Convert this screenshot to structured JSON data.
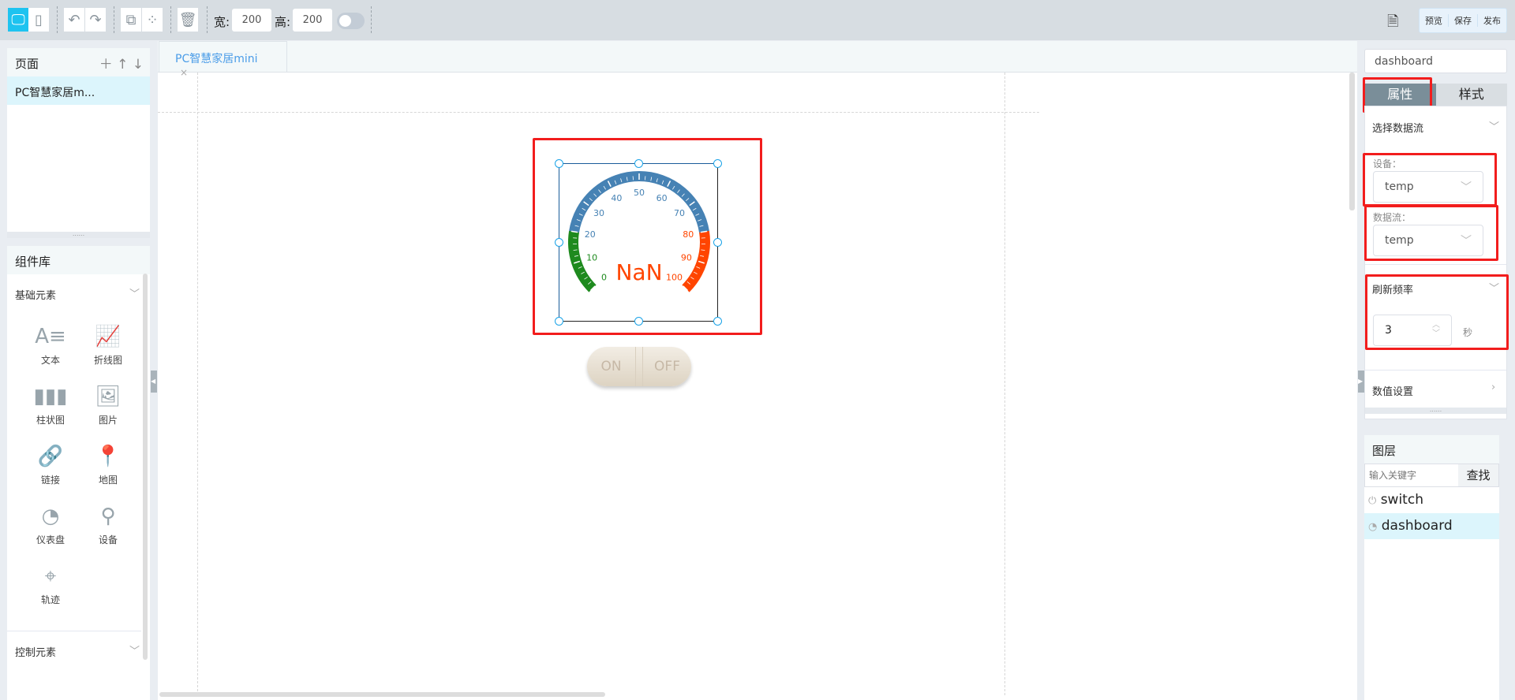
{
  "toolbar": {
    "width_label": "宽:",
    "width_value": "200",
    "height_label": "高:",
    "height_value": "200",
    "preview": "预览",
    "save": "保存",
    "publish": "发布"
  },
  "pages": {
    "title": "页面",
    "items": [
      "PC智慧家居m..."
    ]
  },
  "tab": {
    "label": "PC智慧家居mini",
    "close": "×"
  },
  "library": {
    "title": "组件库",
    "basic": "基础元素",
    "control": "控制元素",
    "items": [
      {
        "label": "文本",
        "icon": "text-icon"
      },
      {
        "label": "折线图",
        "icon": "line-chart-icon"
      },
      {
        "label": "柱状图",
        "icon": "bar-chart-icon"
      },
      {
        "label": "图片",
        "icon": "image-icon"
      },
      {
        "label": "链接",
        "icon": "link-icon"
      },
      {
        "label": "地图",
        "icon": "map-pin-icon"
      },
      {
        "label": "仪表盘",
        "icon": "gauge-icon"
      },
      {
        "label": "设备",
        "icon": "device-icon"
      },
      {
        "label": "轨迹",
        "icon": "track-icon"
      }
    ]
  },
  "gauge": {
    "value_text": "NaN",
    "min": 0,
    "max": 100,
    "labels": [
      "0",
      "10",
      "20",
      "30",
      "40",
      "50",
      "60",
      "70",
      "80",
      "90",
      "100"
    ],
    "ranges": [
      {
        "from": 0,
        "to": 20,
        "color": "#1e8a1e"
      },
      {
        "from": 20,
        "to": 80,
        "color": "#4682b4"
      },
      {
        "from": 80,
        "to": 100,
        "color": "#ff4500"
      }
    ]
  },
  "switch": {
    "on": "ON",
    "off": "OFF"
  },
  "right": {
    "name_value": "dashboard",
    "tab_props": "属性",
    "tab_style": "样式",
    "select_stream": "选择数据流",
    "device_label": "设备：",
    "device_value": "temp",
    "stream_label": "数据流：",
    "stream_value": "temp",
    "refresh": "刷新频率",
    "refresh_value": "3",
    "refresh_unit": "秒",
    "value_settings": "数值设置"
  },
  "layers": {
    "title": "图层",
    "search_placeholder": "输入关键字",
    "search_btn": "查找",
    "items": [
      {
        "label": "switch",
        "icon": "power-icon"
      },
      {
        "label": "dashboard",
        "icon": "gauge-icon",
        "selected": true
      }
    ]
  }
}
